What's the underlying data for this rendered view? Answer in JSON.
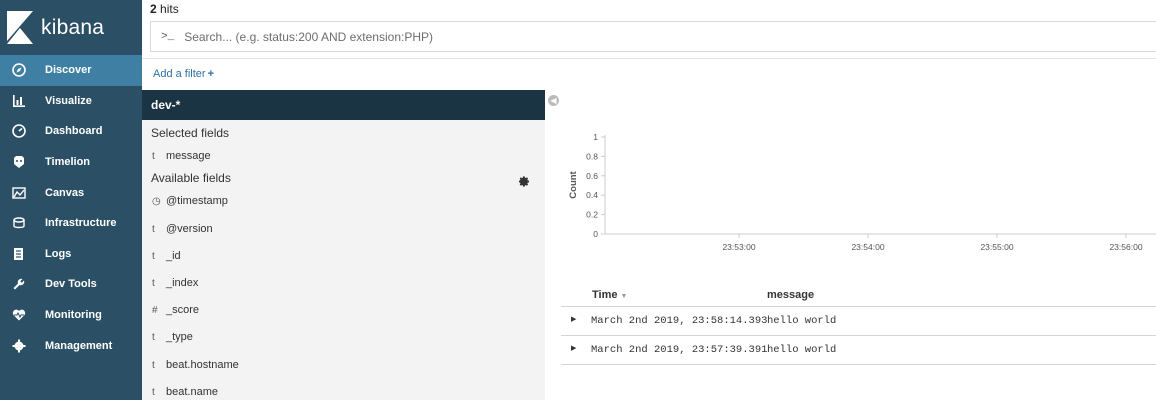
{
  "app": {
    "logo_text": "kibana"
  },
  "nav": [
    {
      "label": "Discover",
      "icon": "compass-icon",
      "active": true
    },
    {
      "label": "Visualize",
      "icon": "bar-chart-icon"
    },
    {
      "label": "Dashboard",
      "icon": "dashboard-icon"
    },
    {
      "label": "Timelion",
      "icon": "timelion-icon"
    },
    {
      "label": "Canvas",
      "icon": "canvas-icon"
    },
    {
      "label": "Infrastructure",
      "icon": "infrastructure-icon"
    },
    {
      "label": "Logs",
      "icon": "logs-icon"
    },
    {
      "label": "Dev Tools",
      "icon": "wrench-icon"
    },
    {
      "label": "Monitoring",
      "icon": "heartbeat-icon"
    },
    {
      "label": "Management",
      "icon": "gear-icon"
    }
  ],
  "hits": {
    "count": "2",
    "label": "hits"
  },
  "search": {
    "prompt": ">_",
    "placeholder": "Search... (e.g. status:200 AND extension:PHP)"
  },
  "filter": {
    "add_label": "Add a filter",
    "add_symbol": "+"
  },
  "fields": {
    "index_pattern": "dev-*",
    "selected_title": "Selected fields",
    "selected": [
      {
        "type": "t",
        "name": "message"
      }
    ],
    "available_title": "Available fields",
    "available": [
      {
        "type": "◷",
        "name": "@timestamp"
      },
      {
        "type": "t",
        "name": "@version"
      },
      {
        "type": "t",
        "name": "_id"
      },
      {
        "type": "t",
        "name": "_index"
      },
      {
        "type": "#",
        "name": "_score"
      },
      {
        "type": "t",
        "name": "_type"
      },
      {
        "type": "t",
        "name": "beat.hostname"
      },
      {
        "type": "t",
        "name": "beat.name"
      }
    ]
  },
  "chart_data": {
    "type": "bar",
    "ylabel": "Count",
    "xlabel": "",
    "ylim": [
      0,
      1
    ],
    "yticks": [
      "0",
      "0.2",
      "0.4",
      "0.6",
      "0.8",
      "1"
    ],
    "xticks": [
      "23:53:00",
      "23:54:00",
      "23:55:00",
      "23:56:00"
    ],
    "values": []
  },
  "table": {
    "columns": [
      "Time",
      "message"
    ],
    "rows": [
      {
        "time": "March 2nd 2019, 23:58:14.393",
        "message": "hello world"
      },
      {
        "time": "March 2nd 2019, 23:57:39.391",
        "message": "hello world"
      }
    ]
  }
}
